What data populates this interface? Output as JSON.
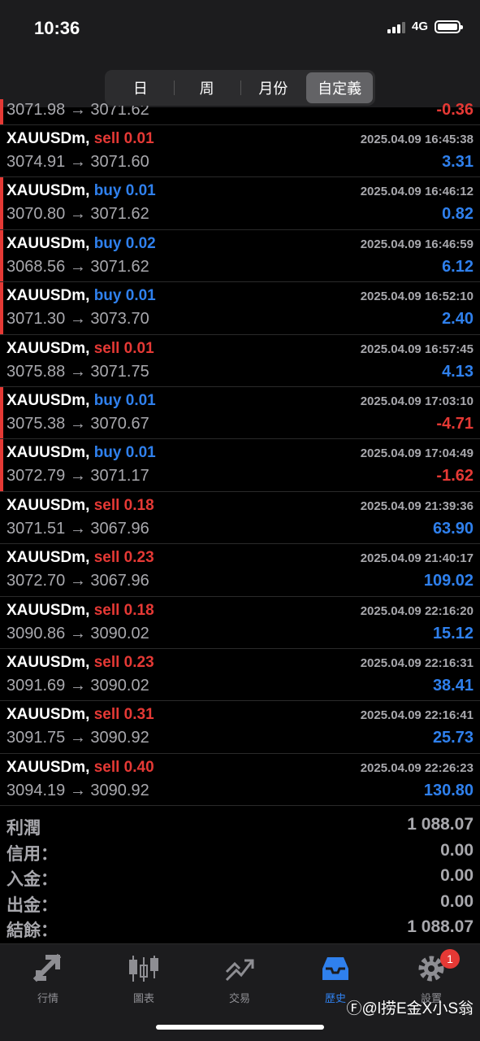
{
  "status": {
    "time": "10:36",
    "network": "4G"
  },
  "segments": [
    {
      "label": "日",
      "active": false
    },
    {
      "label": "周",
      "active": false
    },
    {
      "label": "月份",
      "active": false
    },
    {
      "label": "自定義",
      "active": true
    }
  ],
  "partial_row": {
    "prices": "3071.98 → 3071.62",
    "profit": "-0.36"
  },
  "trades": [
    {
      "symbol": "XAUUSDm,",
      "side": "sell",
      "volume": "0.01",
      "date": "2025.04.09 16:45:38",
      "prices": "3074.91 → 3071.60",
      "profit": "3.31"
    },
    {
      "symbol": "XAUUSDm,",
      "side": "buy",
      "volume": "0.01",
      "date": "2025.04.09 16:46:12",
      "prices": "3070.80 → 3071.62",
      "profit": "0.82"
    },
    {
      "symbol": "XAUUSDm,",
      "side": "buy",
      "volume": "0.02",
      "date": "2025.04.09 16:46:59",
      "prices": "3068.56 → 3071.62",
      "profit": "6.12"
    },
    {
      "symbol": "XAUUSDm,",
      "side": "buy",
      "volume": "0.01",
      "date": "2025.04.09 16:52:10",
      "prices": "3071.30 → 3073.70",
      "profit": "2.40"
    },
    {
      "symbol": "XAUUSDm,",
      "side": "sell",
      "volume": "0.01",
      "date": "2025.04.09 16:57:45",
      "prices": "3075.88 → 3071.75",
      "profit": "4.13"
    },
    {
      "symbol": "XAUUSDm,",
      "side": "buy",
      "volume": "0.01",
      "date": "2025.04.09 17:03:10",
      "prices": "3075.38 → 3070.67",
      "profit": "-4.71"
    },
    {
      "symbol": "XAUUSDm,",
      "side": "buy",
      "volume": "0.01",
      "date": "2025.04.09 17:04:49",
      "prices": "3072.79 → 3071.17",
      "profit": "-1.62"
    },
    {
      "symbol": "XAUUSDm,",
      "side": "sell",
      "volume": "0.18",
      "date": "2025.04.09 21:39:36",
      "prices": "3071.51 → 3067.96",
      "profit": "63.90"
    },
    {
      "symbol": "XAUUSDm,",
      "side": "sell",
      "volume": "0.23",
      "date": "2025.04.09 21:40:17",
      "prices": "3072.70 → 3067.96",
      "profit": "109.02"
    },
    {
      "symbol": "XAUUSDm,",
      "side": "sell",
      "volume": "0.18",
      "date": "2025.04.09 22:16:20",
      "prices": "3090.86 → 3090.02",
      "profit": "15.12"
    },
    {
      "symbol": "XAUUSDm,",
      "side": "sell",
      "volume": "0.23",
      "date": "2025.04.09 22:16:31",
      "prices": "3091.69 → 3090.02",
      "profit": "38.41"
    },
    {
      "symbol": "XAUUSDm,",
      "side": "sell",
      "volume": "0.31",
      "date": "2025.04.09 22:16:41",
      "prices": "3091.75 → 3090.92",
      "profit": "25.73"
    },
    {
      "symbol": "XAUUSDm,",
      "side": "sell",
      "volume": "0.40",
      "date": "2025.04.09 22:26:23",
      "prices": "3094.19 → 3090.92",
      "profit": "130.80"
    }
  ],
  "summary": [
    {
      "label": "利潤",
      "value": "1 088.07"
    },
    {
      "label": "信用：",
      "value": "0.00"
    },
    {
      "label": "入金：",
      "value": "0.00"
    },
    {
      "label": "出金：",
      "value": "0.00"
    },
    {
      "label": "結餘：",
      "value": "1 088.07"
    }
  ],
  "tabs": [
    {
      "label": "行情",
      "icon": "quotes-icon",
      "active": false
    },
    {
      "label": "圖表",
      "icon": "chart-icon",
      "active": false
    },
    {
      "label": "交易",
      "icon": "trade-icon",
      "active": false
    },
    {
      "label": "歷史",
      "icon": "history-icon",
      "active": true
    },
    {
      "label": "設置",
      "icon": "settings-icon",
      "active": false,
      "badge": "1"
    }
  ],
  "watermark": "Ⓕ@l捞E金X小S翁",
  "colors": {
    "buy": "#2f80ed",
    "sell": "#e53935",
    "active_tab": "#2f80ed",
    "marker": "#e53935"
  }
}
